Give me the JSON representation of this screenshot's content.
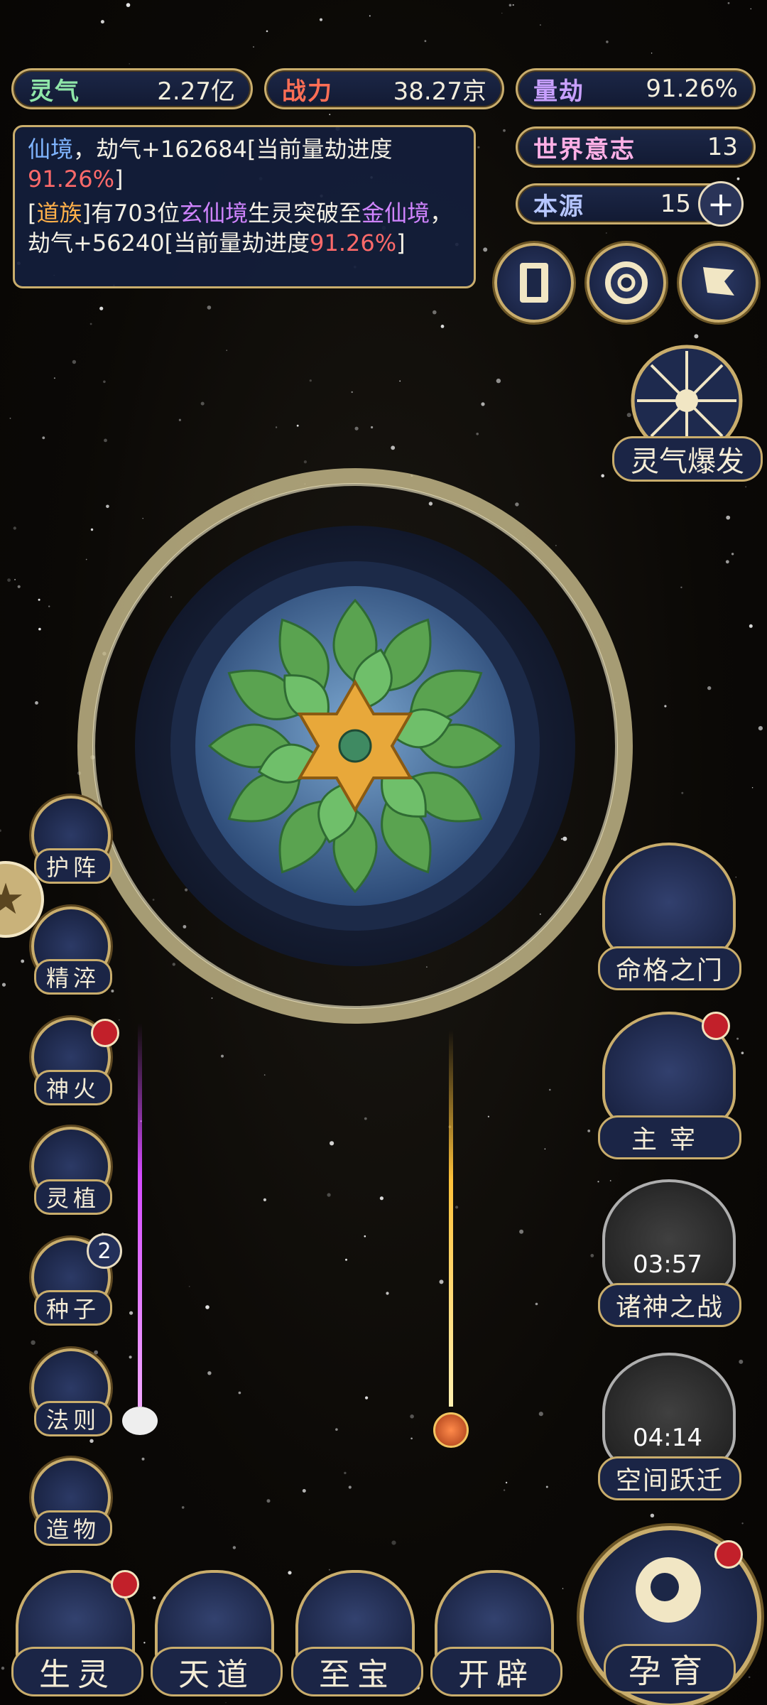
{
  "stats": {
    "lingqi": {
      "label": "灵气",
      "value": "2.27亿"
    },
    "zhanli": {
      "label": "战力",
      "value": "38.27京"
    },
    "liangjie": {
      "label": "量劫",
      "value": "91.26%"
    },
    "shijie": {
      "label": "世界意志",
      "value": "13"
    },
    "benyuan": {
      "label": "本源",
      "value": "15",
      "add": "+"
    }
  },
  "log": {
    "line1_realm": "仙境",
    "line1_text": "，劫气+162684[当前量劫进度",
    "line1_pct": "91.26%",
    "line1_end": "]",
    "line2_open": "[",
    "line2_tribe": "道族",
    "line2_a": "]有703位",
    "line2_realm": "玄仙境",
    "line2_b": "生灵突破至",
    "line2_target": "金仙境",
    "line2_c": "，劫气+56240[当前量劫进度",
    "line2_pct": "91.26%",
    "line2_end": "]"
  },
  "burst_label": "灵气爆发",
  "left_menu": [
    {
      "id": "huzhen",
      "label": "护阵",
      "icon": "taiji-icon"
    },
    {
      "id": "jingcui",
      "label": "精淬",
      "icon": "flame-lotus-icon"
    },
    {
      "id": "shenhuo",
      "label": "神火",
      "icon": "fire-icon",
      "dot": true
    },
    {
      "id": "lingzhi",
      "label": "灵植",
      "icon": "plant-icon"
    },
    {
      "id": "zhongzi",
      "label": "种子",
      "icon": "seed-icon",
      "badge": "2"
    },
    {
      "id": "faze",
      "label": "法则",
      "icon": "rune-icon"
    },
    {
      "id": "zaowu",
      "label": "造物",
      "icon": "diamond-icon"
    }
  ],
  "right_menu": {
    "mingge": "命格之门",
    "zhuzai": "主宰",
    "zhushen": "诸神之战",
    "zhushen_timer": "03:57",
    "kongjian": "空间跃迁",
    "kongjian_timer": "04:14"
  },
  "bottom_menu": [
    {
      "id": "shengling",
      "label": "生灵",
      "dot": true
    },
    {
      "id": "tiandao",
      "label": "天道"
    },
    {
      "id": "zhibao",
      "label": "至宝"
    },
    {
      "id": "kaipi",
      "label": "开辟"
    }
  ],
  "yunyu_label": "孕育",
  "colors": {
    "gold": "#c9ad6c",
    "navy": "#1b2546",
    "red_dot": "#c2202a"
  }
}
